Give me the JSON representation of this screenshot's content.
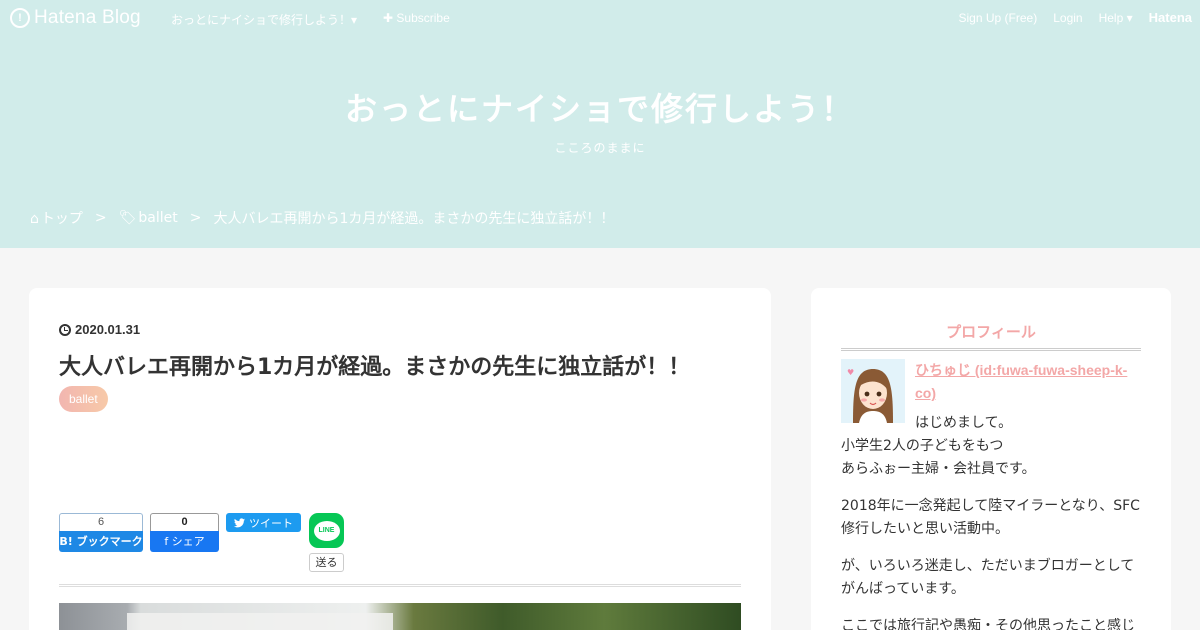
{
  "topbar": {
    "logo_text": "Hatena Blog",
    "blog_name": "おっとにナイショで修行しよう！▾",
    "subscribe": "✚ Subscribe",
    "signup": "Sign Up (Free)",
    "login": "Login",
    "help": "Help ▾",
    "hatena": "Hatena"
  },
  "header": {
    "title": "おっとにナイショで修行しよう！",
    "description": "こころのままに"
  },
  "breadcrumb": {
    "home": "トップ",
    "sep1": ">",
    "category": "ballet",
    "sep2": ">",
    "current": "大人バレエ再開から1カ月が経過。まさかの先生に独立話が！！"
  },
  "entry": {
    "date": "2020.01.31",
    "title": "大人バレエ再開から1カ月が経過。まさかの先生に独立話が！！",
    "category": "ballet"
  },
  "share": {
    "hatebu_count": "6",
    "hatebu_label": "B! ブックマーク",
    "fb_count": "0",
    "fb_label": "f シェア",
    "tweet_label": "ツイート",
    "line_label": "LINE",
    "line_send": "送る"
  },
  "sidebar": {
    "title": "プロフィール",
    "name": "ひちゅじ (id:fuwa-fuwa-sheep-k-co)",
    "bio": [
      "はじめまして。",
      "小学生2人の子どもをもつ",
      "あらふぉー主婦・会社員です。",
      "2018年に一念発起して陸マイラーとなり、SFC修行したいと思い活動中。",
      "が、いろいろ迷走し、ただいまブロガーとしてがんばっています。",
      "ここでは旅行記や愚痴・その他思ったこと感じ"
    ]
  },
  "colors": {
    "header_bg": "#d1ecea",
    "accent_pink": "#f3a7a7",
    "hatebu_blue": "#1e88e5",
    "facebook_blue": "#1877f2",
    "twitter_blue": "#1d9bf0",
    "line_green": "#06c755"
  }
}
